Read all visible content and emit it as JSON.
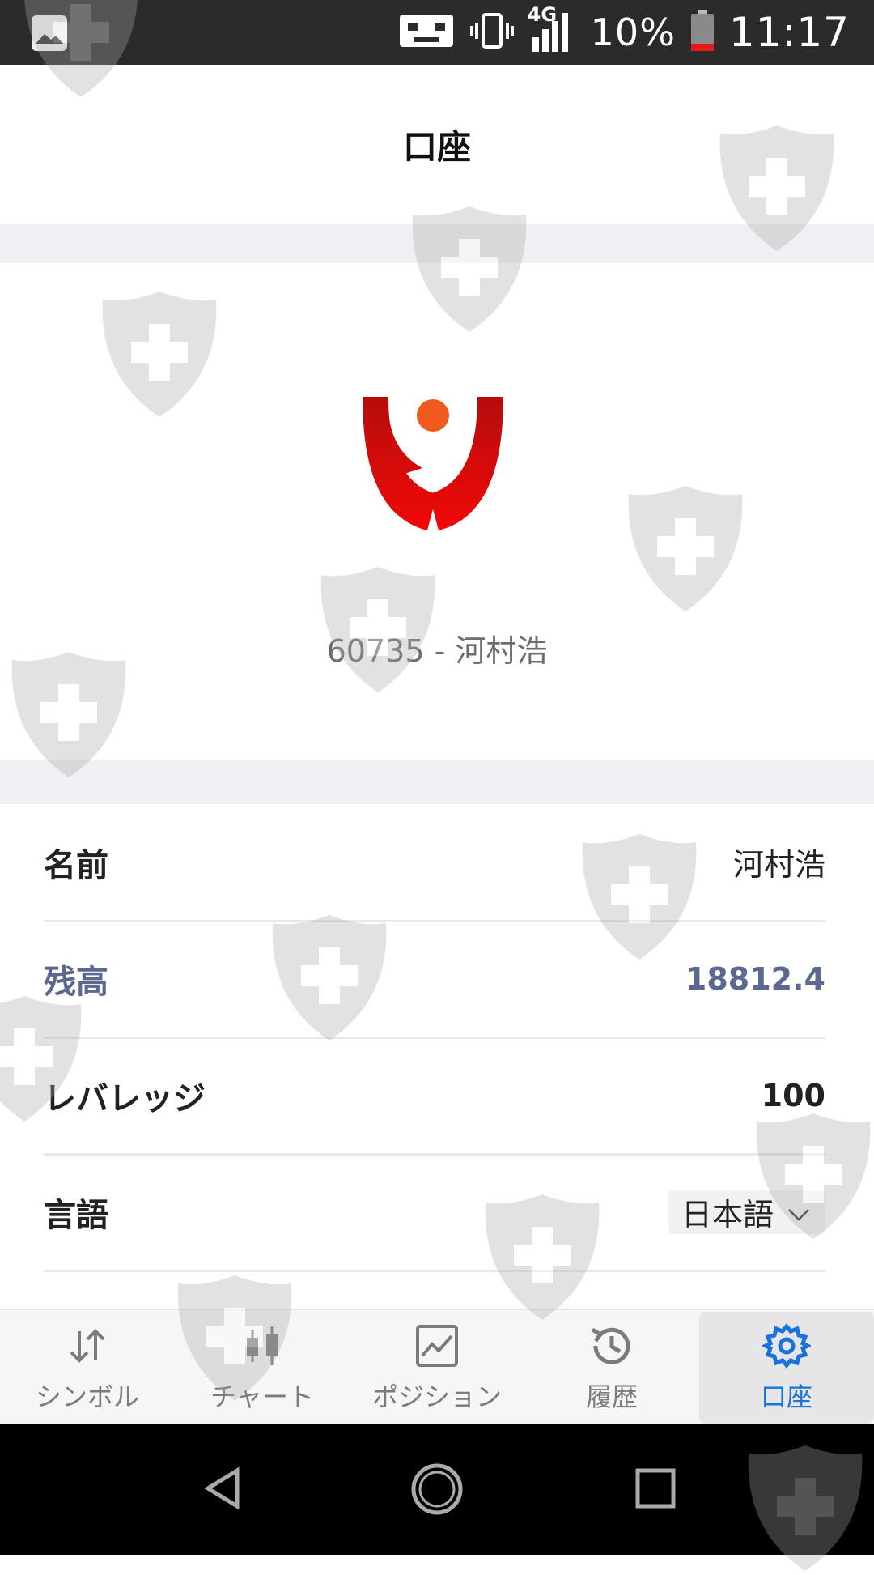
{
  "status_bar": {
    "network": "4G",
    "battery": "10%",
    "time": "11:17"
  },
  "header": {
    "title": "口座"
  },
  "profile": {
    "account_line": "60735 - 河村浩"
  },
  "info": {
    "name_label": "名前",
    "name_value": "河村浩",
    "balance_label": "残高",
    "balance_value": "18812.4",
    "leverage_label": "レバレッジ",
    "leverage_value": "100",
    "language_label": "言語",
    "language_value": "日本語"
  },
  "bottom_nav": {
    "items": [
      {
        "label": "シンボル",
        "icon": "arrows-sort-icon"
      },
      {
        "label": "チャート",
        "icon": "candlestick-icon"
      },
      {
        "label": "ポジション",
        "icon": "line-chart-icon"
      },
      {
        "label": "履歴",
        "icon": "history-clock-icon"
      },
      {
        "label": "口座",
        "icon": "gear-icon"
      }
    ],
    "active_index": 4
  },
  "colors": {
    "accent": "#1a73d8",
    "balance": "#5d6890",
    "logo_red": "#d41010",
    "logo_orange": "#f05a1e"
  }
}
